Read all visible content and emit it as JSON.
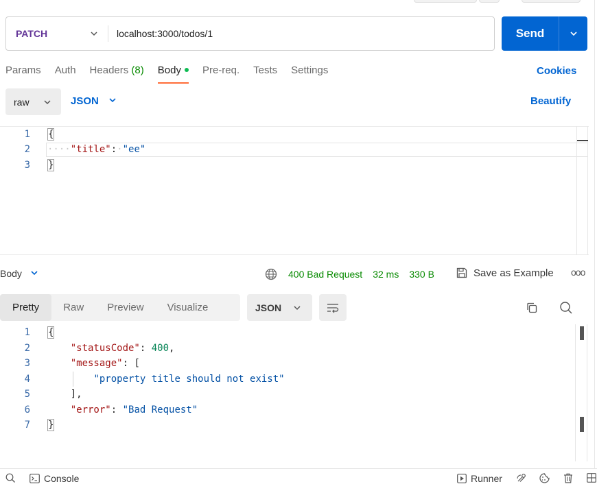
{
  "request": {
    "method": "PATCH",
    "url": "localhost:3000/todos/1",
    "send_label": "Send",
    "tabs": [
      {
        "label": "Params"
      },
      {
        "label": "Auth"
      },
      {
        "label": "Headers",
        "count": "(8)"
      },
      {
        "label": "Body",
        "active": true
      },
      {
        "label": "Pre-req."
      },
      {
        "label": "Tests"
      },
      {
        "label": "Settings"
      }
    ],
    "cookies_label": "Cookies",
    "body_type": "raw",
    "body_format": "JSON",
    "beautify_label": "Beautify",
    "body_lines": [
      {
        "num": "1",
        "text": "{"
      },
      {
        "num": "2",
        "key": "\"title\"",
        "colon": ":",
        "value": "\"ee\""
      },
      {
        "num": "3",
        "text": "}"
      }
    ]
  },
  "response": {
    "section_label": "Body",
    "status": "400 Bad Request",
    "time": "32 ms",
    "size": "330 B",
    "save_label": "Save as Example",
    "more_label": "ooo",
    "view_tabs": [
      "Pretty",
      "Raw",
      "Preview",
      "Visualize"
    ],
    "active_view": "Pretty",
    "format": "JSON",
    "lines": [
      {
        "num": "1",
        "text": "{"
      },
      {
        "num": "2",
        "key": "\"statusCode\"",
        "value": "400",
        "suffix": ","
      },
      {
        "num": "3",
        "key": "\"message\"",
        "value": "[",
        "suffix": ""
      },
      {
        "num": "4",
        "value": "\"property title should not exist\""
      },
      {
        "num": "5",
        "text": "],"
      },
      {
        "num": "6",
        "key": "\"error\"",
        "value": "\"Bad Request\"",
        "suffix": ""
      },
      {
        "num": "7",
        "text": "}"
      }
    ]
  },
  "footer": {
    "console_label": "Console",
    "runner_label": "Runner"
  },
  "colors": {
    "send_blue": "#0265d2",
    "method_purple": "#623497",
    "status_green": "#078a00",
    "active_tab_orange": "#ff6c37"
  }
}
